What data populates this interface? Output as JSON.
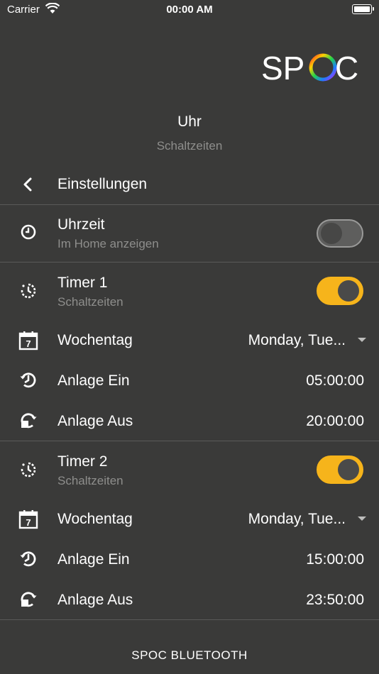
{
  "status_bar": {
    "carrier": "Carrier",
    "time": "00:00 AM"
  },
  "header": {
    "logo": "SPOC",
    "title": "Uhr",
    "subtitle": "Schaltzeiten"
  },
  "back": {
    "label": "Einstellungen"
  },
  "clock": {
    "label": "Uhrzeit",
    "sublabel": "Im Home anzeigen",
    "enabled": false
  },
  "timers": [
    {
      "label": "Timer 1",
      "sublabel": "Schaltzeiten",
      "enabled": true,
      "weekday_label": "Wochentag",
      "weekday_value": "Monday, Tue...",
      "on_label": "Anlage Ein",
      "on_time": "05:00:00",
      "off_label": "Anlage Aus",
      "off_time": "20:00:00"
    },
    {
      "label": "Timer 2",
      "sublabel": "Schaltzeiten",
      "enabled": true,
      "weekday_label": "Wochentag",
      "weekday_value": "Monday, Tue...",
      "on_label": "Anlage Ein",
      "on_time": "15:00:00",
      "off_label": "Anlage Aus",
      "off_time": "23:50:00"
    }
  ],
  "footer": {
    "label": "SPOC BLUETOOTH"
  },
  "colors": {
    "background": "#3a3a39",
    "accent": "#f6b41b",
    "muted_text": "#8e8e8c"
  }
}
